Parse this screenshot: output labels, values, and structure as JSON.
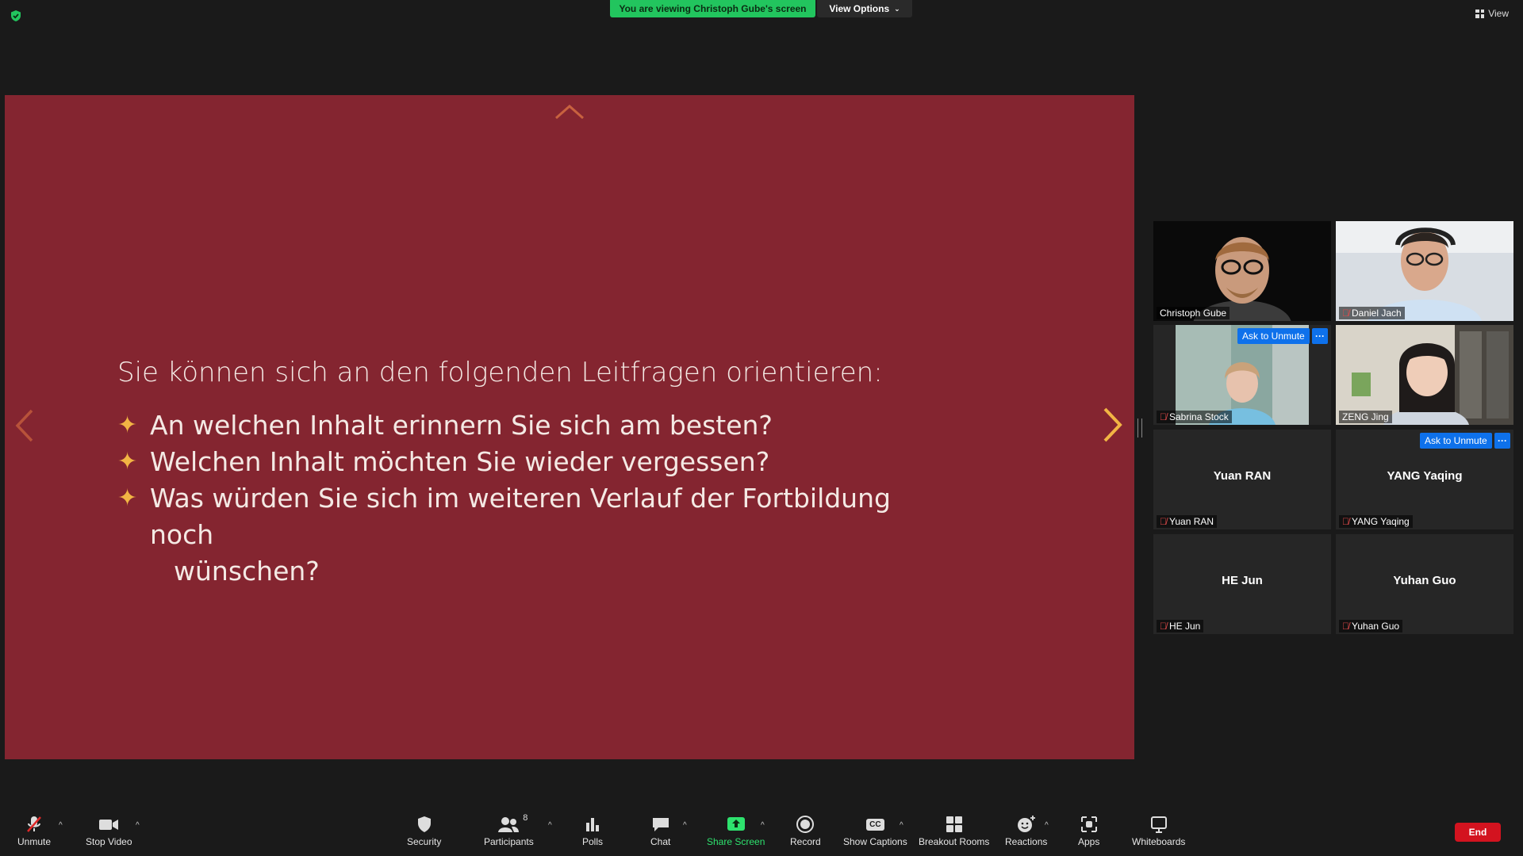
{
  "top": {
    "banner": "You are viewing Christoph Gube's screen",
    "view_options": "View Options",
    "view": "View"
  },
  "slide": {
    "heading": "Sie können sich an den folgenden Leitfragen orientieren:",
    "bullets": [
      "An welchen Inhalt erinnern Sie sich am besten?",
      "Welchen Inhalt möchten Sie wieder vergessen?",
      "Was würden Sie sich im weiteren Verlauf der Fortbildung noch"
    ],
    "bullet3_cont": "wünschen?",
    "bullet_symbol": "✦",
    "bg_color": "#842530",
    "accent_color": "#f2b544"
  },
  "participants": [
    {
      "name": "Christoph Gube",
      "video": true,
      "muted": false
    },
    {
      "name": "Daniel Jach",
      "video": true,
      "muted": true
    },
    {
      "name": "Sabrina Stock",
      "video": true,
      "muted": true,
      "ask_to_unmute": "Ask to Unmute"
    },
    {
      "name": "ZENG Jing",
      "video": true,
      "muted": false,
      "active_speaker": true
    },
    {
      "name": "Yuan RAN",
      "video": false,
      "muted": true
    },
    {
      "name": "YANG Yaqing",
      "video": false,
      "muted": true,
      "ask_to_unmute": "Ask to Unmute"
    },
    {
      "name": "HE Jun",
      "video": false,
      "muted": true
    },
    {
      "name": "Yuhan Guo",
      "video": false,
      "muted": true
    }
  ],
  "more_label": "···",
  "toolbar": {
    "unmute": "Unmute",
    "stop_video": "Stop Video",
    "security": "Security",
    "participants": "Participants",
    "participants_count": "8",
    "polls": "Polls",
    "chat": "Chat",
    "share_screen": "Share Screen",
    "record": "Record",
    "show_captions": "Show Captions",
    "captions_icon": "CC",
    "breakout_rooms": "Breakout Rooms",
    "reactions": "Reactions",
    "apps": "Apps",
    "whiteboards": "Whiteboards",
    "end": "End"
  },
  "colors": {
    "share_green": "#2ee26e",
    "banner_green": "#22c55e",
    "end_red": "#d3131f",
    "ask_blue": "#0e71eb",
    "active_outline": "#c8f22f"
  }
}
